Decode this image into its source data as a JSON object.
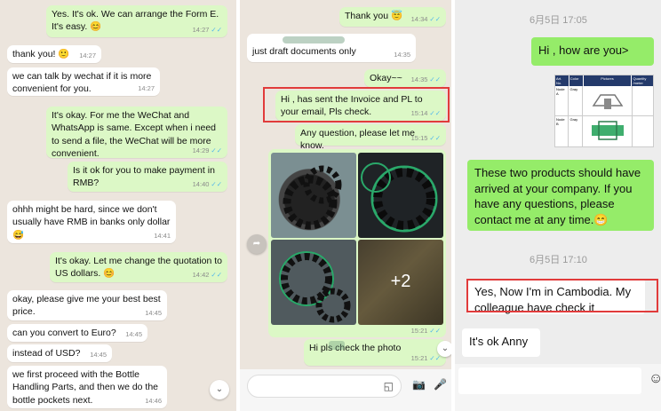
{
  "panel1": {
    "messages": [
      {
        "text": "Yes. It's ok. We can arrange the Form E. It's easy. 😊",
        "time": "14:27",
        "dir": "out"
      },
      {
        "text": "thank you! 🙂",
        "time": "14:27",
        "dir": "in"
      },
      {
        "text": "we can talk by wechat if it is more convenient for you.",
        "time": "14:27",
        "dir": "in"
      },
      {
        "text": "It's okay. For me the WeChat and WhatsApp is same. Except when i need to send a file, the WeChat will be more convenient.",
        "time": "14:29",
        "dir": "out"
      },
      {
        "text": "Is it ok for you to make payment in RMB?",
        "time": "14:40",
        "dir": "out"
      },
      {
        "text": "ohhh might be hard, since we don't usually have RMB in banks only dollar 😅",
        "time": "14:41",
        "dir": "in"
      },
      {
        "text": "It's okay. Let me change the quotation to US dollars. 😊",
        "time": "14:42",
        "dir": "out"
      },
      {
        "text": "okay, please give me your best best price.",
        "time": "14:45",
        "dir": "in"
      },
      {
        "text": "can you convert to Euro?",
        "time": "14:45",
        "dir": "in"
      },
      {
        "text": "instead of USD?",
        "time": "14:45",
        "dir": "in"
      },
      {
        "text": "we first proceed with the Bottle Handling Parts, and then we do the bottle pockets next.",
        "time": "14:46",
        "dir": "in"
      }
    ]
  },
  "panel2": {
    "messages": [
      {
        "text": "Thank you 😇",
        "time": "14:34",
        "dir": "out"
      },
      {
        "text": "just draft documents only",
        "time": "14:35",
        "dir": "in"
      },
      {
        "text": "Okay~~",
        "time": "14:35",
        "dir": "out"
      },
      {
        "text": "Hi , has sent the Invoice and PL to your email, Pls check.",
        "time": "15:14",
        "dir": "out"
      },
      {
        "text": "Any question, please let me know.",
        "time": "15:15",
        "dir": "out"
      },
      {
        "text": "Hi pls check the photo",
        "time": "15:21",
        "dir": "out"
      }
    ],
    "album_time": "15:21",
    "album_more": "+2"
  },
  "panel3": {
    "date1": "6月5日 17:05",
    "date2": "6月5日 17:10",
    "msg_hi": "Hi , how are you>",
    "msg_products": "These two products should have arrived at your company. If you have any questions, please contact me at any time.😁",
    "msg_cambodia": "Yes, Now I'm in Cambodia. My colleague have check it",
    "msg_ok": "It's ok Anny",
    "table_headers": [
      "Art. No.",
      "Color",
      "Pictures",
      "Quantity /meter"
    ],
    "table_rows": [
      [
        "Node A",
        "Gray"
      ],
      [
        "Node B",
        "Gray"
      ]
    ]
  },
  "colors": {
    "whatsapp_out": "#dcf8c6",
    "wechat_out": "#95ec69",
    "highlight": "#e13b3b"
  }
}
